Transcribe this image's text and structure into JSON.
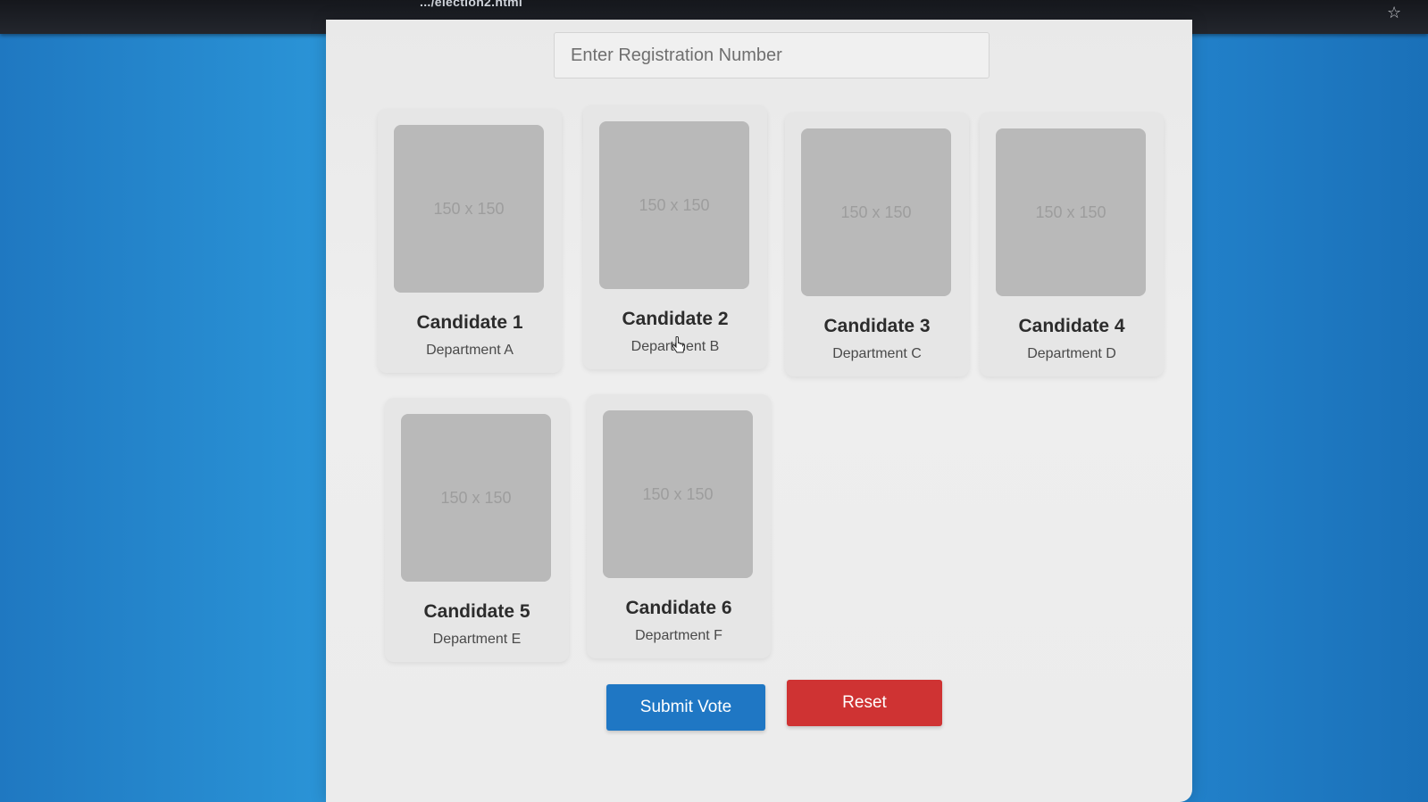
{
  "browser": {
    "url_fragment": ".../election2.html",
    "star_icon": "star-icon"
  },
  "form": {
    "registration_placeholder": "Enter Registration Number"
  },
  "candidates": [
    {
      "name": "Candidate 1",
      "department": "Department A",
      "photo_placeholder": "150 x 150"
    },
    {
      "name": "Candidate 2",
      "department": "Department B",
      "photo_placeholder": "150 x 150"
    },
    {
      "name": "Candidate 3",
      "department": "Department C",
      "photo_placeholder": "150 x 150"
    },
    {
      "name": "Candidate 4",
      "department": "Department D",
      "photo_placeholder": "150 x 150"
    },
    {
      "name": "Candidate 5",
      "department": "Department E",
      "photo_placeholder": "150 x 150"
    },
    {
      "name": "Candidate 6",
      "department": "Department F",
      "photo_placeholder": "150 x 150"
    }
  ],
  "actions": {
    "submit_label": "Submit Vote",
    "reset_label": "Reset"
  },
  "colors": {
    "submit": "#1f77c4",
    "reset": "#cf3333",
    "background": "#2a8ed2"
  }
}
